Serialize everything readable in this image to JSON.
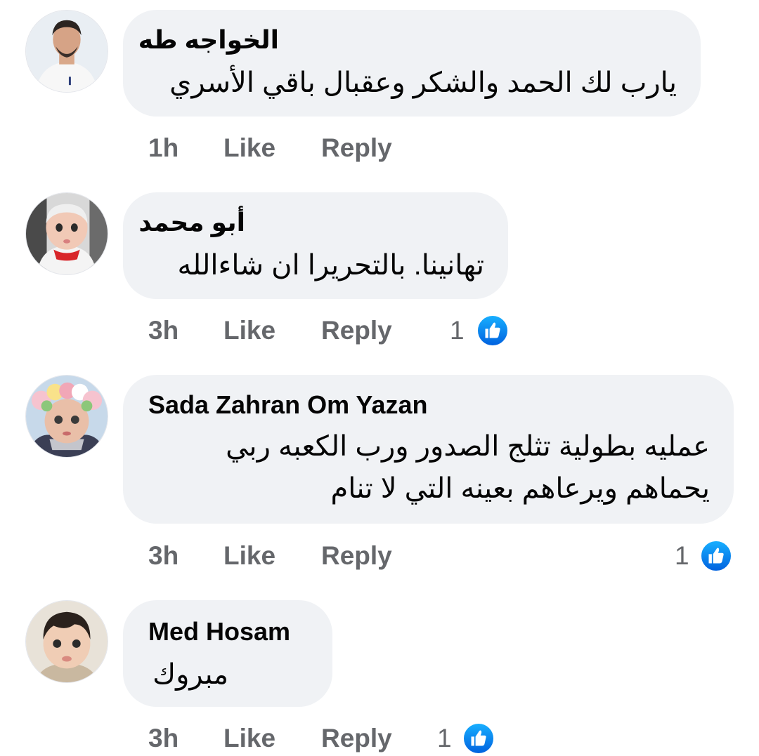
{
  "comments": [
    {
      "author": "الخواجه طه",
      "lines": [
        "يارب لك الحمد والشكر  وعقبال باقي الأسري"
      ],
      "time": "1h",
      "like_label": "Like",
      "reply_label": "Reply",
      "reactions": null
    },
    {
      "author": "أبو محمد",
      "lines": [
        "تهانينا.  بالتحريرا ان شاءالله"
      ],
      "time": "3h",
      "like_label": "Like",
      "reply_label": "Reply",
      "reactions": "1"
    },
    {
      "author": "Sada Zahran Om Yazan",
      "lines": [
        "عمليه بطولية تثلج الصدور ورب الكعبه ربي",
        "يحماهم ويرعاهم بعينه التي لا تنام"
      ],
      "time": "3h",
      "like_label": "Like",
      "reply_label": "Reply",
      "reactions": "1"
    },
    {
      "author": "Med Hosam",
      "lines": [
        "مبروك"
      ],
      "time": "3h",
      "like_label": "Like",
      "reply_label": "Reply",
      "reactions": "1"
    }
  ],
  "icons": {
    "like_reaction": "thumbs-up-icon",
    "avatar": "avatar"
  },
  "colors": {
    "bubble": "#f0f2f5",
    "meta_text": "#65676b",
    "like_blue": "#0a7cff"
  }
}
